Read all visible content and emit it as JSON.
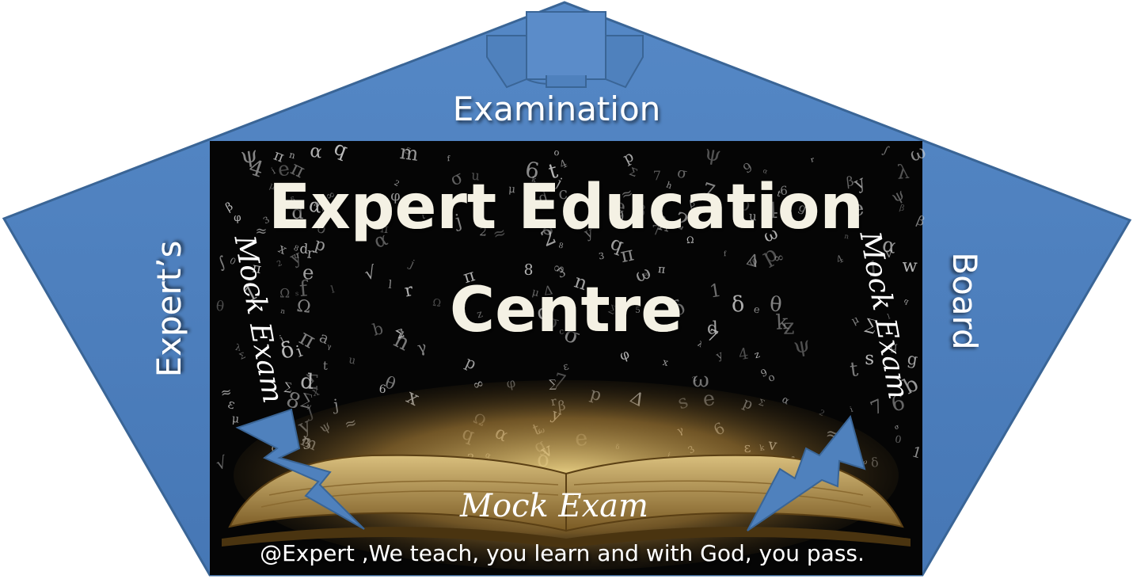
{
  "poster": {
    "top_label": "Examination",
    "left_label": "Expert’s",
    "right_label": "Board",
    "title_line1": "Expert Education",
    "title_line2": "Centre",
    "side_left": "Mock Exam",
    "side_right": "Mock Exam",
    "bottom_script": "Mock Exam",
    "motto": "@Expert ,We teach, you learn and with God, you pass."
  },
  "colors": {
    "pentagon_fill": "#4f81bd",
    "pentagon_stroke": "#3a6596",
    "panel_background": "#050505",
    "title_fill": "#f4f1e4",
    "book_page": "#c8a865"
  },
  "icons": {
    "ribbon": "ribbon-banner-icon",
    "left_bolt": "lightning-bolt-icon",
    "right_bolt": "lightning-bolt-icon",
    "book": "open-book-illustration"
  }
}
